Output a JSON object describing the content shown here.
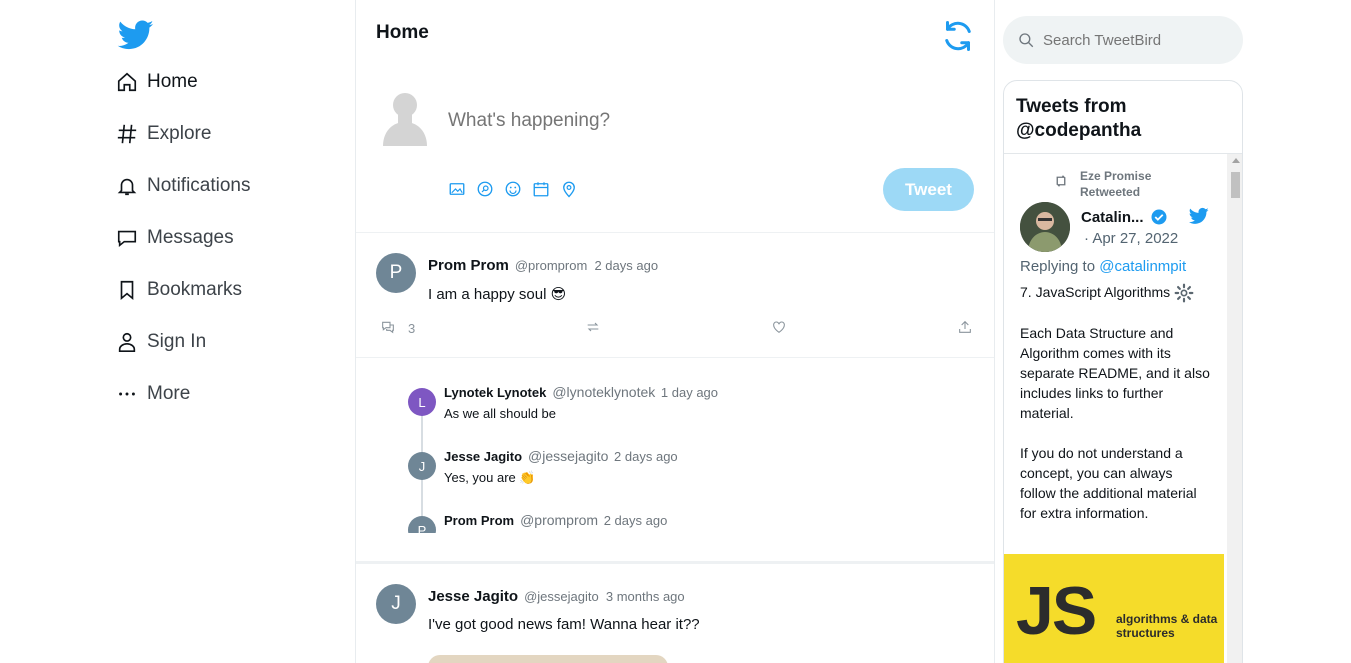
{
  "sidebar": {
    "items": [
      {
        "label": "Home",
        "icon": "home-icon"
      },
      {
        "label": "Explore",
        "icon": "hashtag-icon"
      },
      {
        "label": "Notifications",
        "icon": "bell-icon"
      },
      {
        "label": "Messages",
        "icon": "message-icon"
      },
      {
        "label": "Bookmarks",
        "icon": "bookmark-icon"
      },
      {
        "label": "Sign In",
        "icon": "user-icon"
      },
      {
        "label": "More",
        "icon": "more-icon"
      }
    ]
  },
  "main": {
    "title": "Home",
    "composer": {
      "placeholder": "What's happening?",
      "tweet_label": "Tweet"
    },
    "post1": {
      "avatar_letter": "P",
      "name": "Prom Prom",
      "handle": "@promprom",
      "time": "2 days ago",
      "text": "I am a happy soul 😎",
      "reply_count": "3"
    },
    "replies": [
      {
        "avatar_letter": "L",
        "avatar_color": "#7e57c2",
        "name": "Lynotek Lynotek",
        "handle": "@lynoteklynotek",
        "time": "1 day ago",
        "text": "As we all should be"
      },
      {
        "avatar_letter": "J",
        "avatar_color": "#6f8696",
        "name": "Jesse Jagito",
        "handle": "@jessejagito",
        "time": "2 days ago",
        "text": "Yes, you are 👏"
      },
      {
        "avatar_letter": "P",
        "avatar_color": "#6f8696",
        "name": "Prom Prom",
        "handle": "@promprom",
        "time": "2 days ago",
        "text": ""
      }
    ],
    "post2": {
      "avatar_letter": "J",
      "name": "Jesse Jagito",
      "handle": "@jessejagito",
      "time": "3 months ago",
      "text": "I've got good news fam! Wanna hear it??"
    }
  },
  "right": {
    "search_placeholder": "Search TweetBird",
    "widget": {
      "title": "Tweets from @codepantha",
      "retweeted_by": "Eze Promise Retweeted",
      "author": "Catalin...",
      "date": "· Apr 27, 2022",
      "replying_prefix": "Replying to ",
      "replying_to": "@catalinmpit",
      "line1": "7. JavaScript Algorithms",
      "para1": "Each Data Structure and Algorithm comes with its separate README, and it also includes links to further material.",
      "para2": "If you do not understand a concept, you can always follow the additional material for extra information.",
      "card_big": "JS",
      "card_sub": "algorithms & data structures"
    }
  },
  "colors": {
    "brand": "#1d9bf0",
    "tweet_button": "#9dd9f6",
    "card_yellow": "#f5dc2a"
  }
}
